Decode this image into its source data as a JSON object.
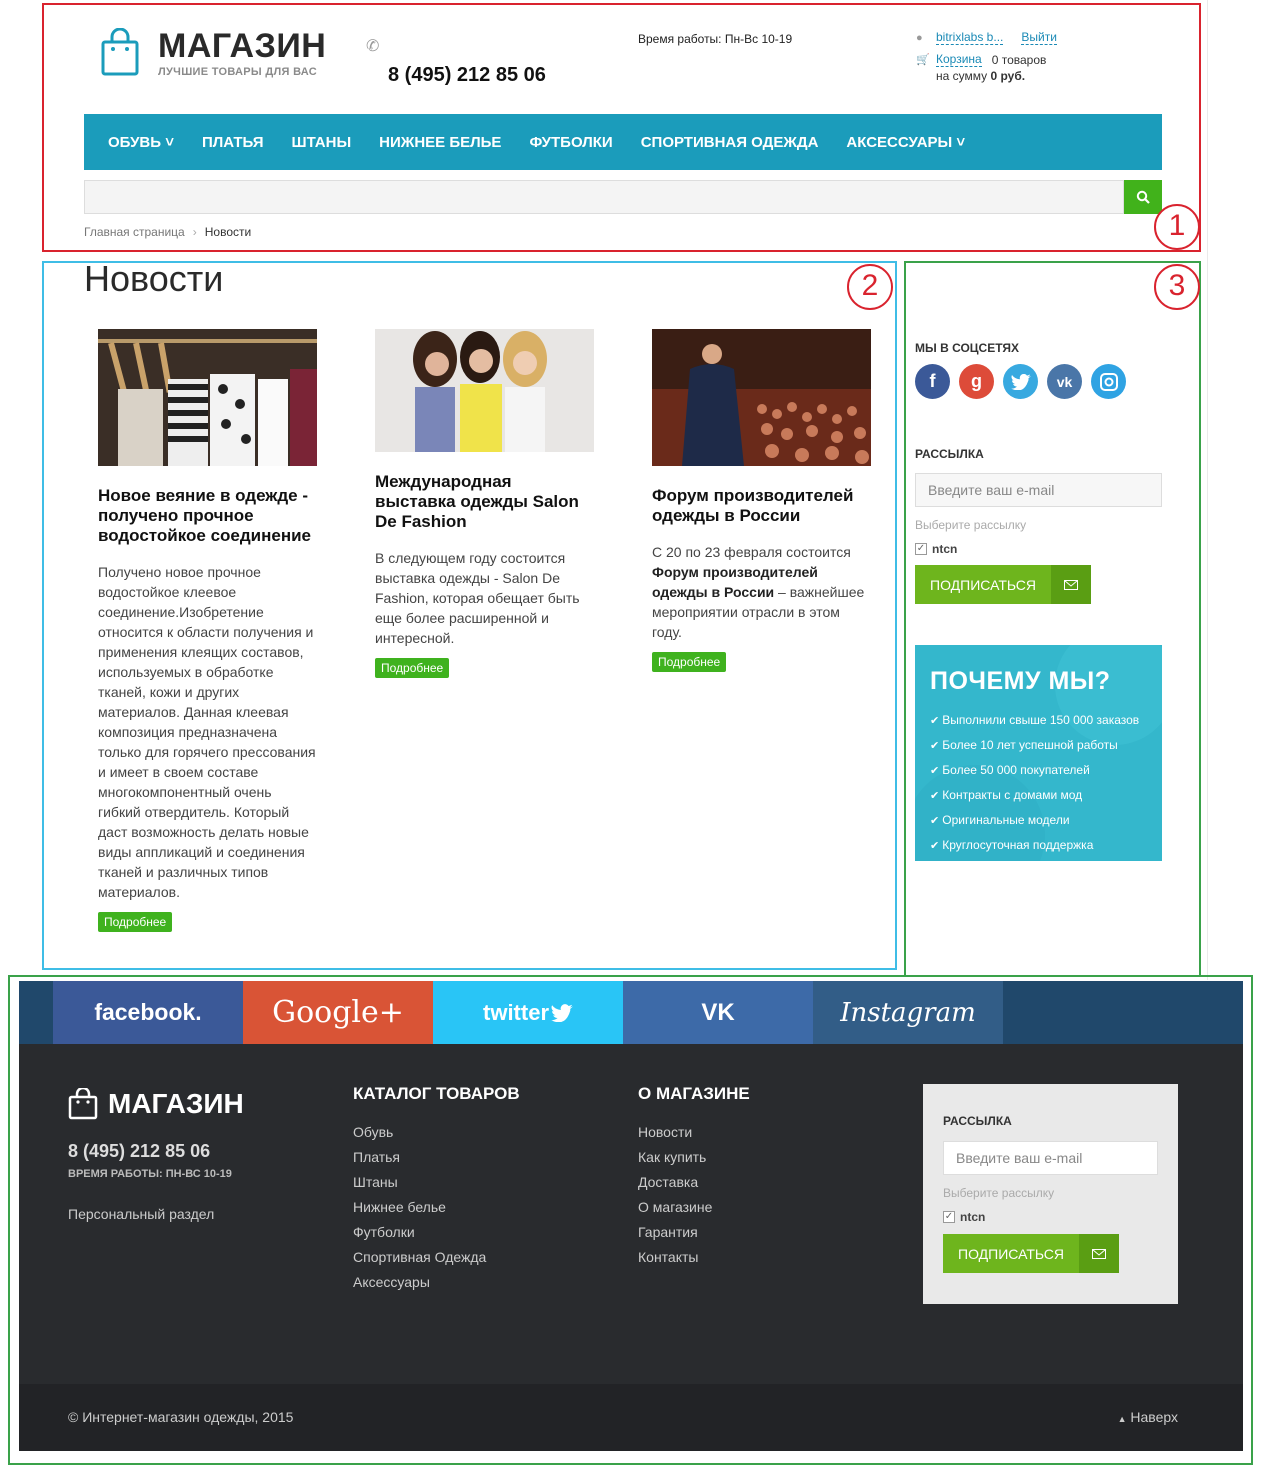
{
  "header": {
    "logo_title": "МАГАЗИН",
    "logo_subtitle": "ЛУЧШИЕ ТОВАРЫ ДЛЯ ВАС",
    "phone": "8 (495) 212 85 06",
    "work_hours": "Время работы: Пн-Вс 10-19",
    "user_name": "bitrixlabs b...",
    "logout": "Выйти",
    "cart_label": "Корзина",
    "cart_count": "0 товаров",
    "cart_sum_prefix": "на сумму",
    "cart_sum": "0 руб."
  },
  "nav": [
    {
      "label": "ОБУВЬ ˅"
    },
    {
      "label": "ПЛАТЬЯ"
    },
    {
      "label": "ШТАНЫ"
    },
    {
      "label": "НИЖНЕЕ БЕЛЬЕ"
    },
    {
      "label": "ФУТБОЛКИ"
    },
    {
      "label": "СПОРТИВНАЯ ОДЕЖДА"
    },
    {
      "label": "АКСЕССУАРЫ ˅"
    }
  ],
  "breadcrumb": {
    "home": "Главная страница",
    "separator": "›",
    "current": "Новости"
  },
  "page_title": "Новости",
  "news": [
    {
      "title": "Новое веяние в одежде - получено прочное водостойкое соединение",
      "text": "Получено новое прочное водостойкое клеевое соединение.Изобретение относится к области получения и применения клеящих составов, используемых в обработке тканей, кожи и других материалов. Данная клеевая композиция предназначена только для горячего прессования и имеет в своем составе многокомпонентный очень гибкий отвердитель. Который даст возможность делать новые виды аппликаций и соединения тканей и различных типов материалов.",
      "more": "Подробнее"
    },
    {
      "title": "Международная выставка одежды Salon De Fashion",
      "text": "В следующем году состоится выставка одежды - Salon De Fashion, которая обещает быть еще более расширенной и интересной.",
      "more": "Подробнее"
    },
    {
      "title": "Форум производителей одежды в России",
      "text_before": "С 20 по 23 февраля состоится",
      "text_bold": "Форум производителей одежды в России",
      "text_after": "– важнейшее мероприятии отрасли в этом году.",
      "more": "Подробнее"
    }
  ],
  "sidebar": {
    "social_title": "МЫ В СОЦСЕТЯХ",
    "subscribe_title": "РАССЫЛКА",
    "email_placeholder": "Введите ваш e-mail",
    "choose_hint": "Выберите рассылку",
    "checkbox_label": "ntcn",
    "subscribe_button": "ПОДПИСАТЬСЯ",
    "why_title": "ПОЧЕМУ МЫ?",
    "why_items": [
      "Выполнили свыше 150 000 заказов",
      "Более 10 лет успешной работы",
      "Более 50 000 покупателей",
      "Контракты с домами мод",
      "Оригинальные модели",
      "Круглосуточная поддержка"
    ]
  },
  "social_strip": {
    "facebook": "facebook.",
    "google": "Google+",
    "twitter": "twitter",
    "vk": "VK",
    "instagram": "Instagram"
  },
  "footer": {
    "logo": "МАГАЗИН",
    "phone": "8 (495) 212 85 06",
    "hours": "ВРЕМЯ РАБОТЫ: ПН-ВС 10-19",
    "personal": "Персональный раздел",
    "catalog_title": "КАТАЛОГ ТОВАРОВ",
    "catalog": [
      "Обувь",
      "Платья",
      "Штаны",
      "Нижнее белье",
      "Футболки",
      "Спортивная Одежда",
      "Аксессуары"
    ],
    "about_title": "О МАГАЗИНЕ",
    "about": [
      "Новости",
      "Как купить",
      "Доставка",
      "О магазине",
      "Гарантия",
      "Контакты"
    ],
    "subscribe_title": "РАССЫЛКА",
    "email_placeholder": "Введите ваш e-mail",
    "choose_hint": "Выберите рассылку",
    "checkbox_label": "ntcn",
    "subscribe_button": "ПОДПИСАТЬСЯ",
    "copyright": "© Интернет-магазин одежды, 2015",
    "to_top": "Наверх"
  },
  "annotations": [
    "1",
    "2",
    "3"
  ],
  "colors": {
    "nav": "#1b9cbb",
    "accent_green": "#3fb21e",
    "why_bg": "#34b7cc",
    "footer_bg": "#292b2e",
    "facebook": "#3b5998",
    "google": "#dd4b39",
    "twitter": "#1da1f2",
    "vk": "#4a76a8",
    "instagram": "#3f729b"
  }
}
